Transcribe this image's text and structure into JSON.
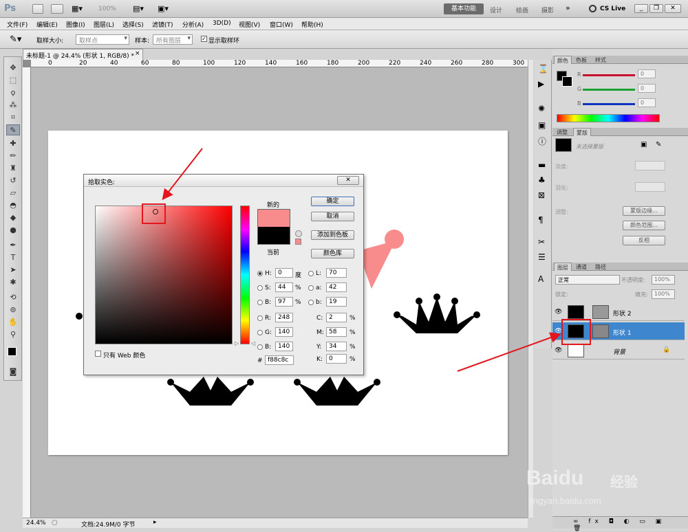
{
  "titlebar": {
    "app_icon": "Ps",
    "zoom": "100%",
    "workspaces": [
      "基本功能",
      "设计",
      "绘画",
      "摄影"
    ],
    "more": "»",
    "cs_live": "CS Live"
  },
  "menus": [
    "文件(F)",
    "编辑(E)",
    "图像(I)",
    "图层(L)",
    "选择(S)",
    "滤镜(T)",
    "分析(A)",
    "3D(D)",
    "视图(V)",
    "窗口(W)",
    "帮助(H)"
  ],
  "options": {
    "sample_size_label": "取样大小:",
    "sample_size_value": "取样点",
    "sample_label": "样本:",
    "sample_value": "所有图层",
    "show_ring": "显示取样环"
  },
  "document": {
    "tab_title": "未标题-1 @ 24.4% (形状 1, RGB/8) *",
    "close": "×",
    "ruler_ticks": [
      "0",
      "20",
      "40",
      "60",
      "80",
      "100",
      "120",
      "140",
      "160",
      "180",
      "200",
      "220",
      "240",
      "260",
      "280",
      "300"
    ],
    "zoom": "24.4%",
    "doc_info": "文档:24.9M/0 字节"
  },
  "dialog": {
    "title": "拾取实色:",
    "new_label": "新的",
    "current_label": "当前",
    "ok": "确定",
    "cancel": "取消",
    "add_swatch": "添加到色板",
    "color_lib": "颜色库",
    "web_only": "只有 Web 颜色",
    "fields": {
      "H": {
        "label": "H:",
        "value": "0",
        "unit": "度"
      },
      "S": {
        "label": "S:",
        "value": "44",
        "unit": "%"
      },
      "B": {
        "label": "B:",
        "value": "97",
        "unit": "%"
      },
      "R": {
        "label": "R:",
        "value": "248"
      },
      "G": {
        "label": "G:",
        "value": "140"
      },
      "Bb": {
        "label": "B:",
        "value": "140"
      },
      "L": {
        "label": "L:",
        "value": "70"
      },
      "a": {
        "label": "a:",
        "value": "42"
      },
      "b": {
        "label": "b:",
        "value": "19"
      },
      "C": {
        "label": "C:",
        "value": "2",
        "unit": "%"
      },
      "M": {
        "label": "M:",
        "value": "58",
        "unit": "%"
      },
      "Y": {
        "label": "Y:",
        "value": "34",
        "unit": "%"
      },
      "K": {
        "label": "K:",
        "value": "0",
        "unit": "%"
      },
      "hex_label": "#",
      "hex": "f88c8c"
    },
    "new_color": "#f88c8c",
    "current_color": "#000000"
  },
  "panels": {
    "color_tabs": [
      "颜色",
      "色板",
      "样式"
    ],
    "rgb_labels": [
      "R",
      "G",
      "B"
    ],
    "rgb_values": [
      "0",
      "0",
      "0"
    ],
    "adjust_tabs": [
      "调整",
      "蒙版"
    ],
    "mask_hint": "未选择蒙版",
    "density": "浓度:",
    "feather": "羽化:",
    "refine": "调整:",
    "mask_edge": "蒙版边缘...",
    "color_range": "颜色范围...",
    "invert": "反相",
    "layer_tabs": [
      "图层",
      "通道",
      "路径"
    ],
    "blend_mode": "正常",
    "opacity_label": "不透明度:",
    "opacity": "100%",
    "lock_label": "锁定:",
    "fill_label": "填充:",
    "fill": "100%",
    "layers": [
      "形状 2",
      "形状 1",
      "背景"
    ]
  },
  "watermark": {
    "brand": "Baidu",
    "cn": "经验",
    "url": "jingyan.baidu.com"
  },
  "colors": {
    "accent": "#3e87cf",
    "annotation": "#e3161e",
    "picked": "#f88c8c"
  }
}
